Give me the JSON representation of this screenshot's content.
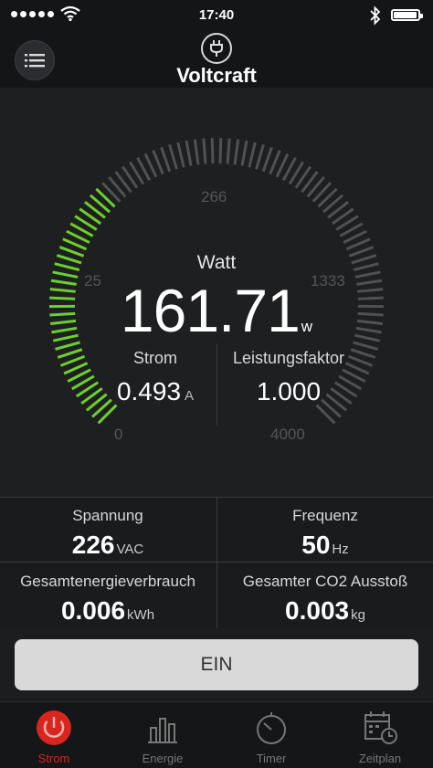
{
  "status_bar": {
    "time": "17:40"
  },
  "header": {
    "title": "Voltcraft",
    "menu_icon": "list-icon",
    "device_icon": "plug-icon"
  },
  "gauge": {
    "label": "Watt",
    "value": "161.71",
    "unit": "w",
    "ticks": [
      "0",
      "25",
      "266",
      "1333",
      "4000"
    ],
    "level_fraction": 0.33,
    "active_color": "#6fcf2a",
    "inactive_color": "#505153"
  },
  "current": {
    "label": "Strom",
    "value": "0.493",
    "unit": "A"
  },
  "power_factor": {
    "label": "Leistungsfaktor",
    "value": "1.000"
  },
  "stats": {
    "voltage": {
      "label": "Spannung",
      "value": "226",
      "unit": "VAC"
    },
    "frequency": {
      "label": "Frequenz",
      "value": "50",
      "unit": "Hz"
    },
    "energy": {
      "label": "Gesamtenergieverbrauch",
      "value": "0.006",
      "unit": "kWh"
    },
    "co2": {
      "label": "Gesamter CO2 Ausstoß",
      "value": "0.003",
      "unit": "kg"
    }
  },
  "toggle_button": {
    "label": "EIN"
  },
  "tabs": [
    {
      "label": "Strom",
      "icon": "power-icon",
      "active": true,
      "color": "#d8261f"
    },
    {
      "label": "Energie",
      "icon": "bar-chart-icon",
      "active": false
    },
    {
      "label": "Timer",
      "icon": "timer-icon",
      "active": false
    },
    {
      "label": "Zeitplan",
      "icon": "calendar-clock-icon",
      "active": false
    }
  ]
}
